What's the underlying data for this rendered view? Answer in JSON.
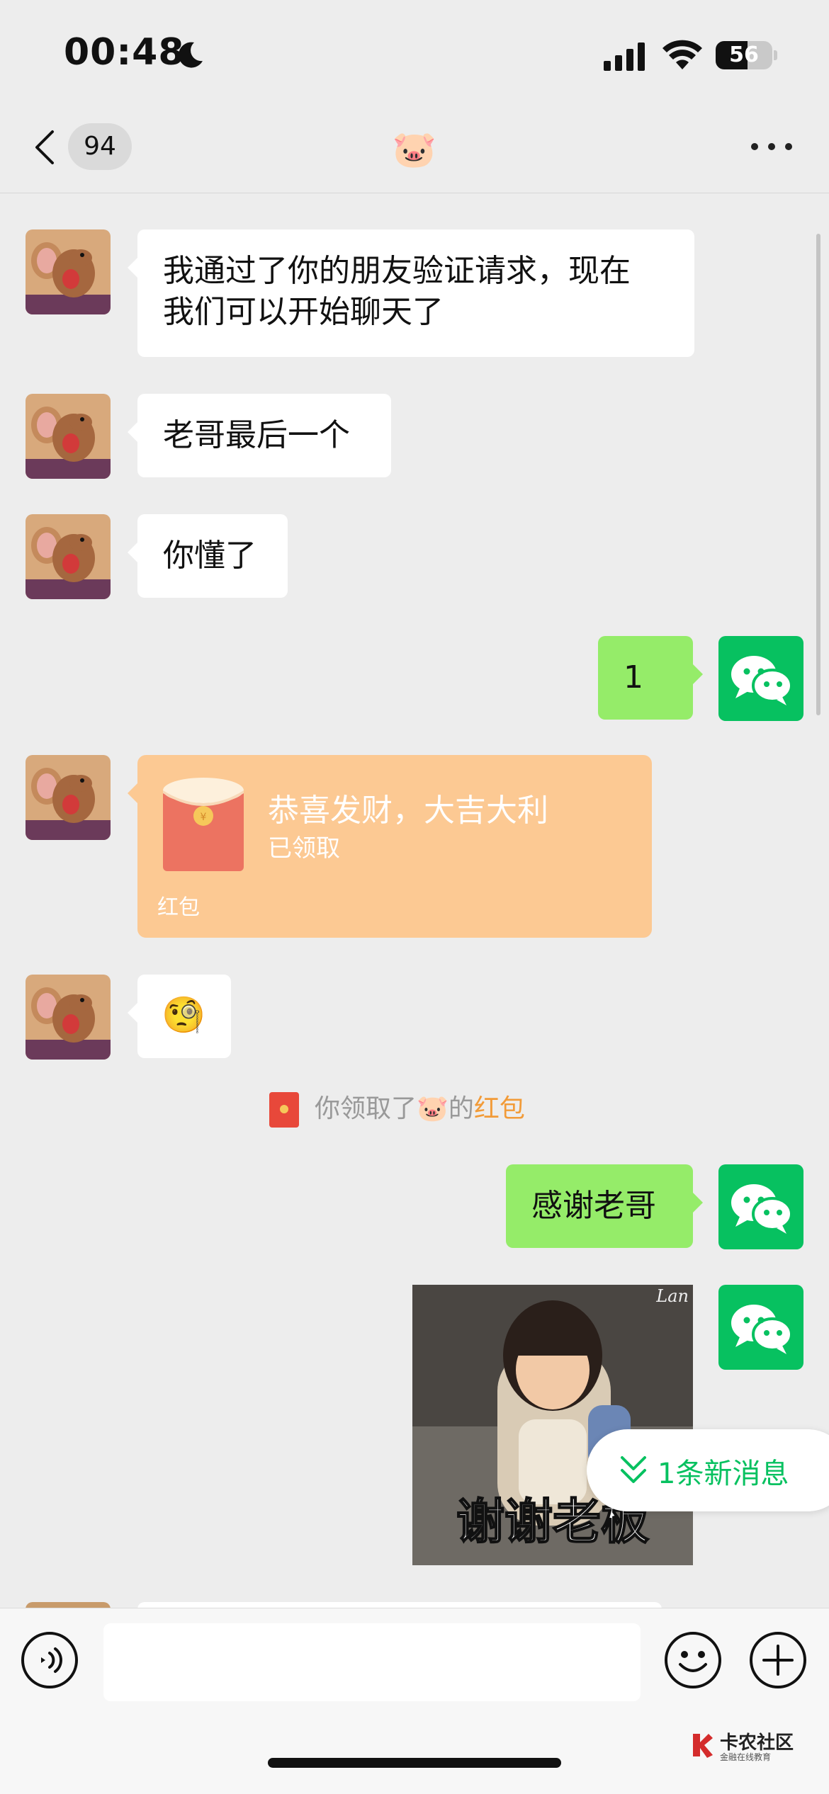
{
  "status_bar": {
    "time": "00:48",
    "battery_level": "56",
    "battery_fraction": 0.56
  },
  "nav": {
    "unread_count": "94",
    "title": "🐷"
  },
  "messages": [
    {
      "side": "left",
      "text": "我通过了你的朋友验证请求，现在\n我们可以开始聊天了"
    },
    {
      "side": "left",
      "text": "老哥最后一个"
    },
    {
      "side": "left",
      "text": "你懂了"
    },
    {
      "side": "right",
      "text": "1"
    },
    {
      "side": "left",
      "type": "red_packet",
      "greeting": "恭喜发财，大吉大利",
      "status": "已领取",
      "label": "红包"
    },
    {
      "side": "left",
      "type": "emoji",
      "text": "🧐"
    },
    {
      "side": "right",
      "text": "感谢老哥"
    },
    {
      "side": "right",
      "type": "sticker",
      "caption": "谢谢老板",
      "watermark": "Lan"
    }
  ],
  "system_notice": {
    "prefix": "你领取了",
    "name": "🐷",
    "middle": "的",
    "link": "红包"
  },
  "new_message_pill": {
    "label": "1条新消息"
  },
  "input_bar": {
    "placeholder": ""
  },
  "watermark": {
    "title": "卡农社区",
    "subtitle": "金融在线教育"
  },
  "colors": {
    "background": "#ededed",
    "bubble_green": "#95ec69",
    "bubble_white": "#ffffff",
    "red_packet": "#fcc993",
    "wechat_green": "#07c160",
    "link_orange": "#f29b38"
  }
}
